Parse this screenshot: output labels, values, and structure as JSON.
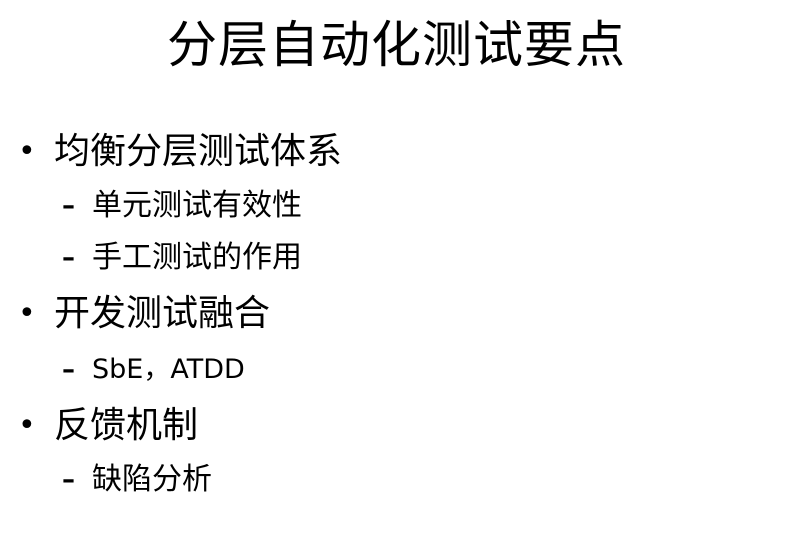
{
  "slide": {
    "title": "分层自动化测试要点",
    "items": [
      {
        "label": "均衡分层测试体系",
        "children": [
          "单元测试有效性",
          "手工测试的作用"
        ]
      },
      {
        "label": "开发测试融合",
        "children": [
          "SbE，ATDD"
        ]
      },
      {
        "label": "反馈机制",
        "children": [
          "缺陷分析"
        ]
      }
    ]
  },
  "symbols": {
    "bullet": "•",
    "dash": "–"
  }
}
